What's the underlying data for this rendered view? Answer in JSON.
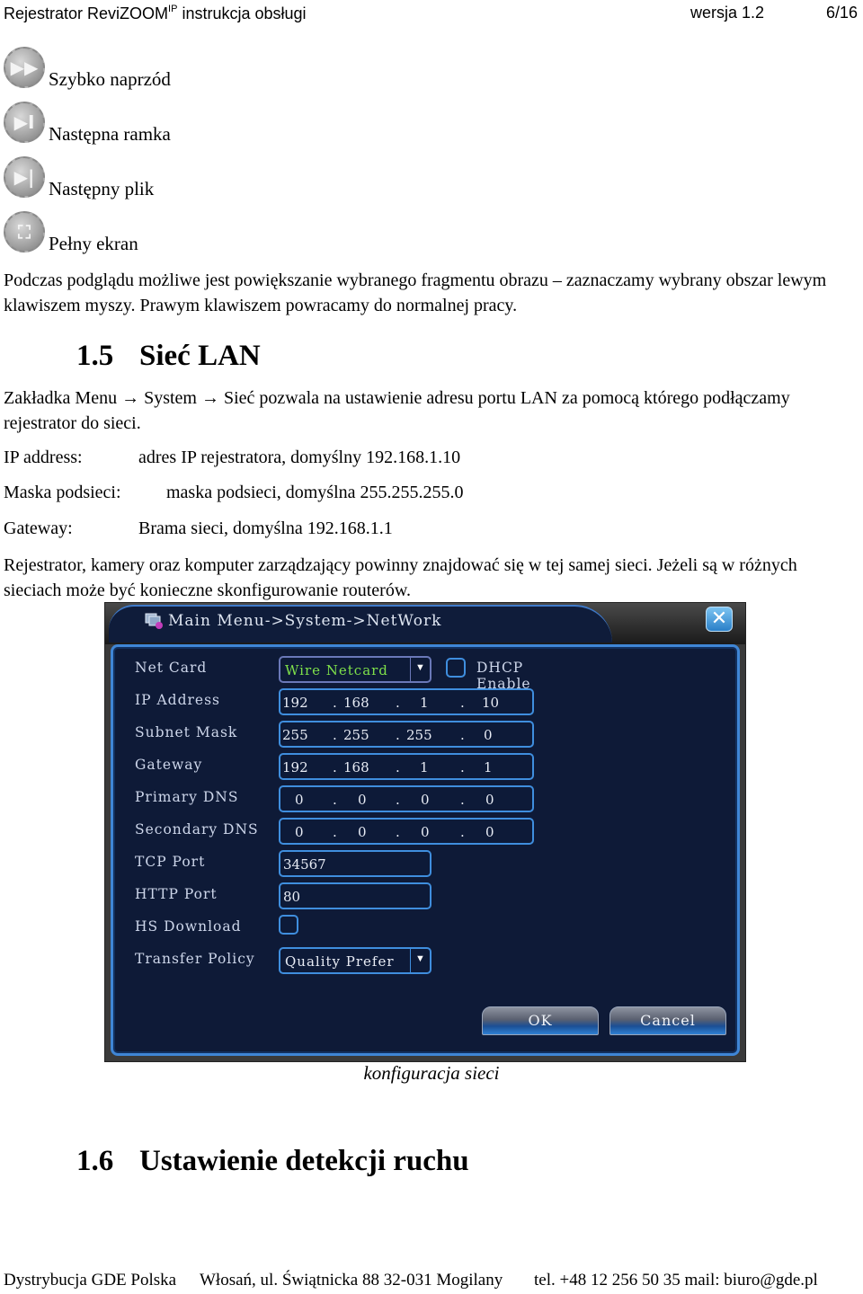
{
  "header": {
    "title_prefix": "Rejestrator ReviZOOM",
    "title_sup": "IP",
    "title_suffix": " instrukcja obsługi",
    "version": "wersja 1.2",
    "page": "6/16"
  },
  "controls": [
    {
      "icon": "fast-forward-icon",
      "glyph": "▶▶",
      "label": "Szybko naprzód"
    },
    {
      "icon": "next-frame-icon",
      "glyph": "▶I",
      "label": "Następna ramka"
    },
    {
      "icon": "next-file-icon",
      "glyph": "▶|",
      "label": "Następny plik"
    },
    {
      "icon": "fullscreen-icon",
      "glyph": "⛶",
      "label": "Pełny ekran"
    }
  ],
  "paragraph_zoom": "Podczas podglądu możliwe jest powiększanie wybranego fragmentu obrazu – zaznaczamy wybrany obszar lewym klawiszem myszy. Prawym klawiszem powracamy do normalnej pracy.",
  "section_lan": {
    "number": "1.5",
    "title": "Sieć LAN"
  },
  "paragraph_lan": "Zakładka Menu → System → Sieć pozwala na ustawienie adresu portu LAN za pomocą którego podłączamy rejestrator do sieci.",
  "params": [
    {
      "key": "IP address:",
      "value": "adres IP rejestratora, domyślny 192.168.1.10"
    },
    {
      "key": "Maska podsieci:",
      "value": "maska podsieci, domyślna 255.255.255.0"
    },
    {
      "key": "Gateway:",
      "value": "Brama sieci, domyślna 192.168.1.1"
    }
  ],
  "paragraph_network": "Rejestrator, kamery oraz komputer zarządzający powinny znajdować się w tej samej sieci. Jeżeli są w różnych sieciach może być konieczne skonfigurowanie routerów.",
  "dialog": {
    "title": "Main Menu->System->NetWork",
    "net_card": {
      "label": "Net Card",
      "value": "Wire Netcard",
      "value_color": "#7ee04a"
    },
    "dhcp": {
      "label": "DHCP Enable",
      "checked": false
    },
    "ip_address": {
      "label": "IP Address",
      "octets": [
        "192",
        "168",
        "1",
        "10"
      ]
    },
    "subnet_mask": {
      "label": "Subnet Mask",
      "octets": [
        "255",
        "255",
        "255",
        "0"
      ]
    },
    "gateway": {
      "label": "Gateway",
      "octets": [
        "192",
        "168",
        "1",
        "1"
      ]
    },
    "primary_dns": {
      "label": "Primary DNS",
      "octets": [
        "0",
        "0",
        "0",
        "0"
      ]
    },
    "secondary_dns": {
      "label": "Secondary DNS",
      "octets": [
        "0",
        "0",
        "0",
        "0"
      ]
    },
    "tcp_port": {
      "label": "TCP Port",
      "value": "34567"
    },
    "http_port": {
      "label": "HTTP Port",
      "value": "80"
    },
    "hs_download": {
      "label": "HS Download",
      "checked": false
    },
    "transfer_policy": {
      "label": "Transfer Policy",
      "value": "Quality Prefer"
    },
    "ok_label": "OK",
    "cancel_label": "Cancel"
  },
  "caption": "konfiguracja sieci",
  "section_motion": {
    "number": "1.6",
    "title": "Ustawienie detekcji ruchu"
  },
  "footer": {
    "company": "Dystrybucja GDE Polska",
    "address": "Włosań, ul. Świątnicka 88 32-031 Mogilany",
    "contact": "tel. +48 12 256 50 35 mail: biuro@gde.pl"
  }
}
